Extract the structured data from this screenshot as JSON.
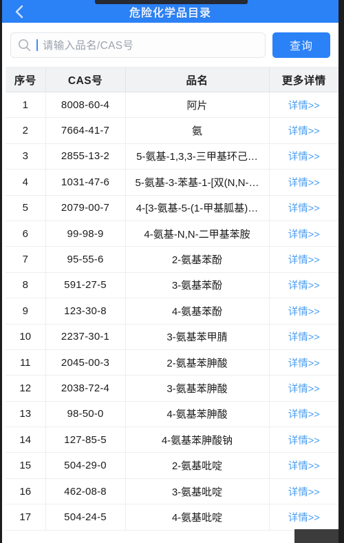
{
  "statusbar": {
    "notch": "phone-notch"
  },
  "navbar": {
    "back_icon": "chevron-left-icon",
    "title": "危险化学品目录"
  },
  "search": {
    "icon": "search-icon",
    "value": "",
    "placeholder": "请输入品名/CAS号",
    "button_label": "查询",
    "caret_visible": true
  },
  "colors": {
    "brand_blue": "#2b81f6",
    "link_blue": "#4a9df0",
    "header_gray": "#f1f2f4",
    "placeholder_gray": "#9aa3ad",
    "notch_dark": "#252a33"
  },
  "table": {
    "columns": [
      "序号",
      "CAS号",
      "品名",
      "更多详情"
    ],
    "detail_label": "详情>>",
    "rows": [
      {
        "idx": "1",
        "cas": "8008-60-4",
        "name": "阿片"
      },
      {
        "idx": "2",
        "cas": "7664-41-7",
        "name": "氨"
      },
      {
        "idx": "3",
        "cas": "2855-13-2",
        "name": "5-氨基-1,3,3-三甲基环己…"
      },
      {
        "idx": "4",
        "cas": "1031-47-6",
        "name": "5-氨基-3-苯基-1-[双(N,N-…"
      },
      {
        "idx": "5",
        "cas": "2079-00-7",
        "name": "4-[3-氨基-5-(1-甲基胍基)…"
      },
      {
        "idx": "6",
        "cas": "99-98-9",
        "name": "4-氨基-N,N-二甲基苯胺"
      },
      {
        "idx": "7",
        "cas": "95-55-6",
        "name": "2-氨基苯酚"
      },
      {
        "idx": "8",
        "cas": "591-27-5",
        "name": "3-氨基苯酚"
      },
      {
        "idx": "9",
        "cas": "123-30-8",
        "name": "4-氨基苯酚"
      },
      {
        "idx": "10",
        "cas": "2237-30-1",
        "name": "3-氨基苯甲腈"
      },
      {
        "idx": "11",
        "cas": "2045-00-3",
        "name": "2-氨基苯胂酸"
      },
      {
        "idx": "12",
        "cas": "2038-72-4",
        "name": "3-氨基苯胂酸"
      },
      {
        "idx": "13",
        "cas": "98-50-0",
        "name": "4-氨基苯胂酸"
      },
      {
        "idx": "14",
        "cas": "127-85-5",
        "name": "4-氨基苯胂酸钠"
      },
      {
        "idx": "15",
        "cas": "504-29-0",
        "name": "2-氨基吡啶"
      },
      {
        "idx": "16",
        "cas": "462-08-8",
        "name": "3-氨基吡啶"
      },
      {
        "idx": "17",
        "cas": "504-24-5",
        "name": "4-氨基吡啶"
      }
    ]
  }
}
